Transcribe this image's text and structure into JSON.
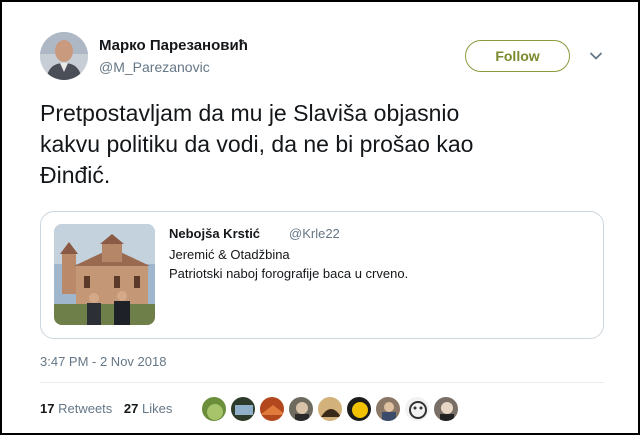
{
  "author": {
    "name": "Марко Парезановић",
    "handle": "@M_Parezanovic"
  },
  "follow_label": "Follow",
  "tweet": {
    "line1": "Pretpostavljam da mu je Slaviša objasnio",
    "line2": "kakvu politiku da vodi, da ne bi prošao kao",
    "line3": "Đinđić."
  },
  "quoted": {
    "name": "Nebojša Krstić",
    "handle": "@Krle22",
    "line1": "Jeremić & Otadžbina",
    "line2": "Patriotski naboj forografije baca u crveno."
  },
  "timestamp": "3:47 PM - 2 Nov 2018",
  "stats": {
    "retweets_count": "17",
    "retweets_label": "Retweets",
    "likes_count": "27",
    "likes_label": "Likes"
  },
  "colors": {
    "follow_accent": "#7a8a2c",
    "secondary_text": "#657786",
    "border": "#ccd6dd"
  },
  "icons": {
    "caret": "chevron-down-icon"
  }
}
